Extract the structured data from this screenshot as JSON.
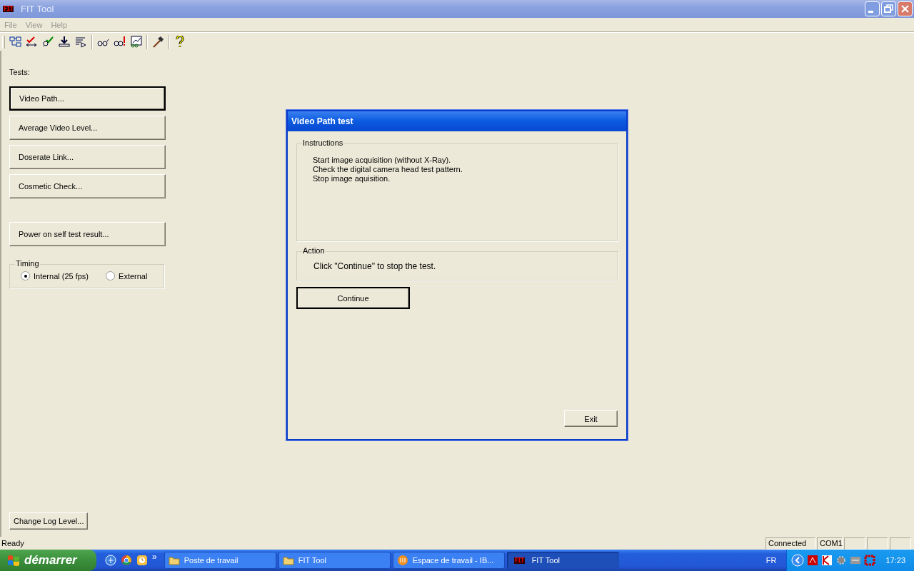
{
  "window": {
    "title": "FIT Tool",
    "logo": "FIT"
  },
  "menu": [
    {
      "label": "File"
    },
    {
      "label": "View"
    },
    {
      "label": "Help"
    }
  ],
  "tests": {
    "label": "Tests:",
    "buttons": [
      {
        "label": "Video Path...",
        "focused": true
      },
      {
        "label": "Average Video Level...",
        "focused": false
      },
      {
        "label": "Doserate Link...",
        "focused": false
      },
      {
        "label": "Cosmetic Check...",
        "focused": false
      }
    ]
  },
  "power_button": "Power on self test result...",
  "timing": {
    "legend": "Timing",
    "options": [
      {
        "label": "Internal (25 fps)",
        "selected": true
      },
      {
        "label": "External",
        "selected": false
      }
    ]
  },
  "log_button": "Change Log Level...",
  "dialog": {
    "title": "Video Path test",
    "instructions": {
      "legend": "Instructions",
      "lines": [
        "Start image acquisition (without X-Ray).",
        "Check the digital camera head test pattern.",
        "Stop image aquisition."
      ]
    },
    "action": {
      "legend": "Action",
      "text": "Click \"Continue\" to stop the test."
    },
    "continue": "Continue",
    "exit": "Exit"
  },
  "status_bar": {
    "message": "Ready",
    "panes": [
      "Connected",
      "COM1"
    ]
  },
  "taskbar": {
    "start": "démarrer",
    "more": "»",
    "tasks": [
      {
        "label": "Poste de travail",
        "kind": "folder",
        "selected": false
      },
      {
        "label": "FIT Tool",
        "kind": "folder",
        "selected": false
      },
      {
        "label": "Espace de travail - IB...",
        "kind": "app",
        "selected": false
      },
      {
        "label": "FIT Tool",
        "kind": "fit",
        "logo": "FIT",
        "selected": true
      }
    ],
    "language": "FR",
    "clock": "17:23"
  }
}
